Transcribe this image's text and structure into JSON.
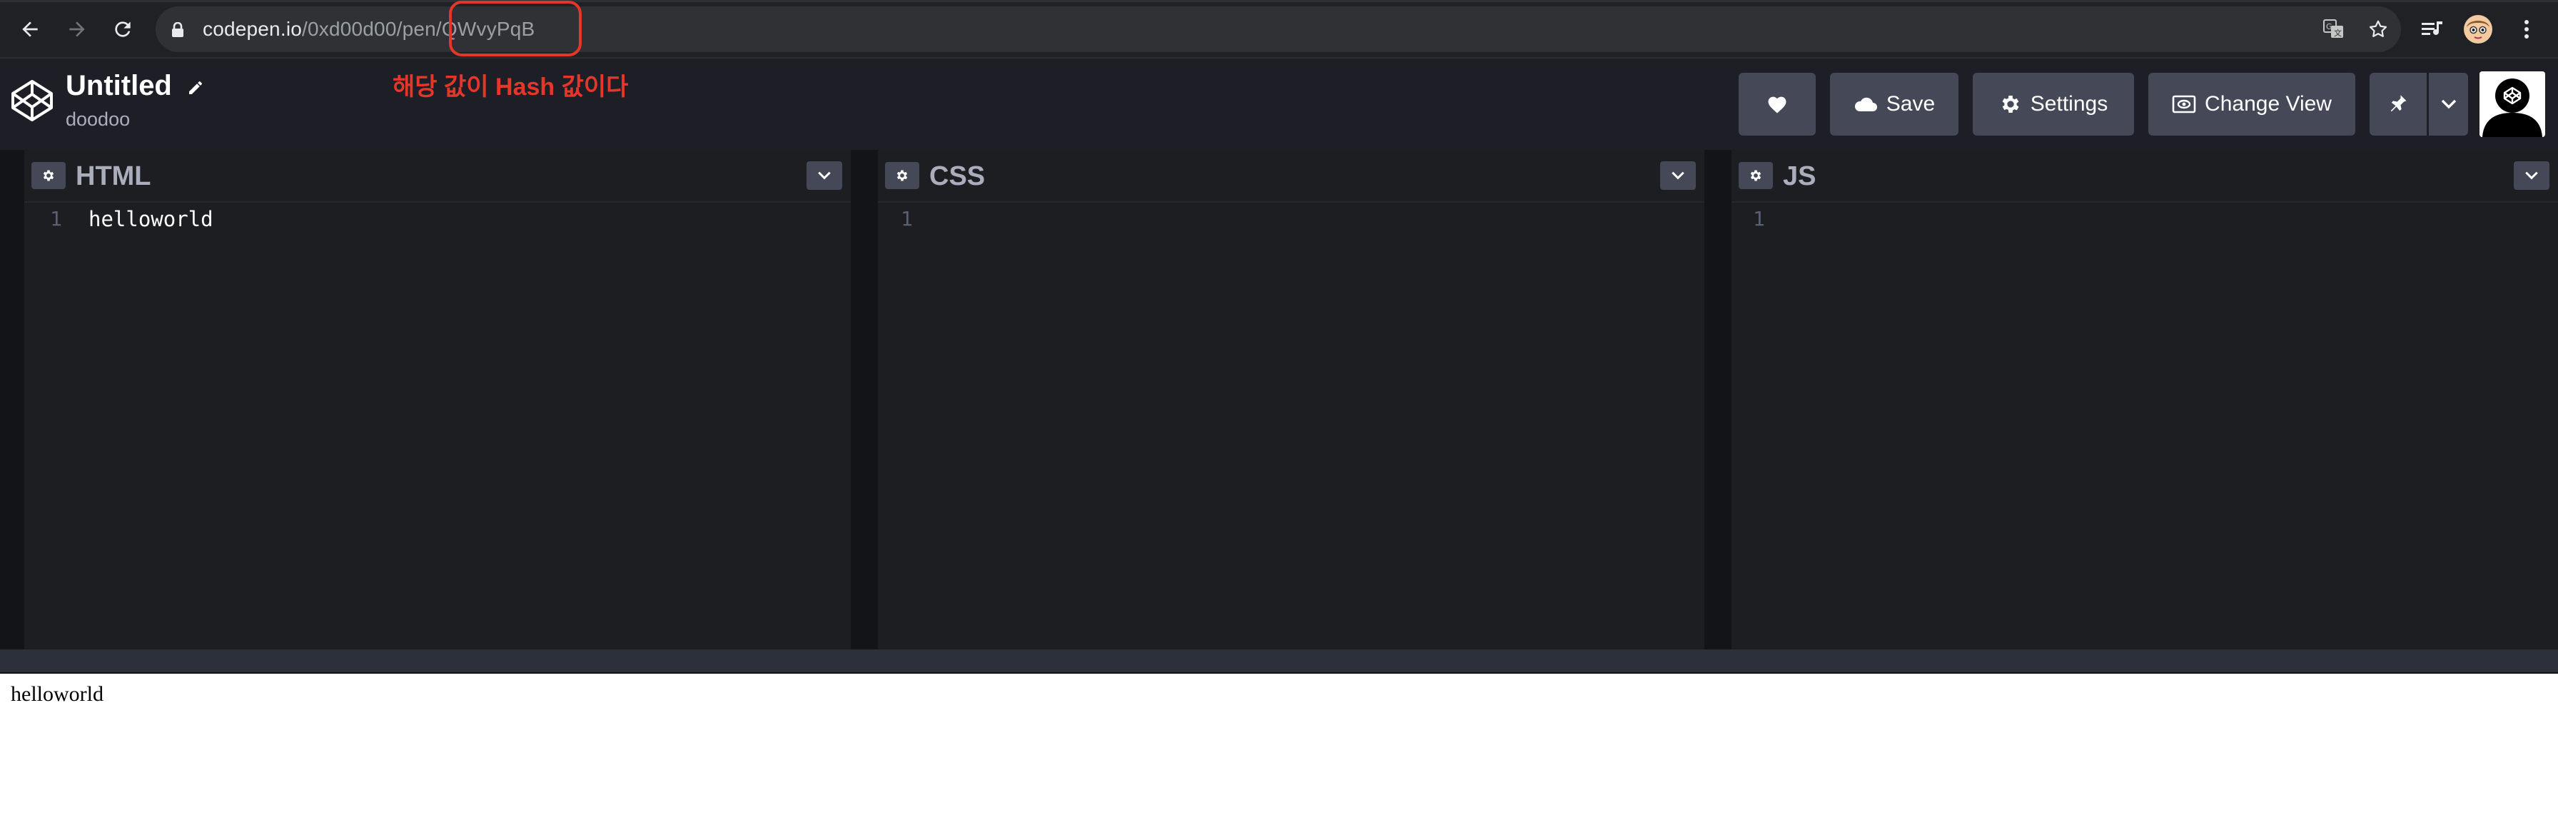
{
  "browser": {
    "url_host": "codepen.io",
    "url_path": "/0xd00d00/pen/",
    "url_hash": "QWvyPqB",
    "icons": [
      "back-icon",
      "forward-icon",
      "reload-icon",
      "lock-icon",
      "translate-icon",
      "star-icon",
      "media-icon",
      "profile-avatar",
      "menu-icon"
    ]
  },
  "header": {
    "title": "Untitled",
    "user": "doodoo",
    "annotation": "해당 값이 Hash 값이다",
    "save_label": "Save",
    "settings_label": "Settings",
    "change_view_label": "Change View"
  },
  "editors": [
    {
      "lang": "HTML",
      "line": "1",
      "code": "helloworld"
    },
    {
      "lang": "CSS",
      "line": "1",
      "code": ""
    },
    {
      "lang": "JS",
      "line": "1",
      "code": ""
    }
  ],
  "preview": {
    "text": "helloworld"
  },
  "colors": {
    "annotation_red": "#e5362a",
    "header_bg": "#1e1f26",
    "button_bg": "#444857",
    "editor_bg": "#1d1e22"
  }
}
